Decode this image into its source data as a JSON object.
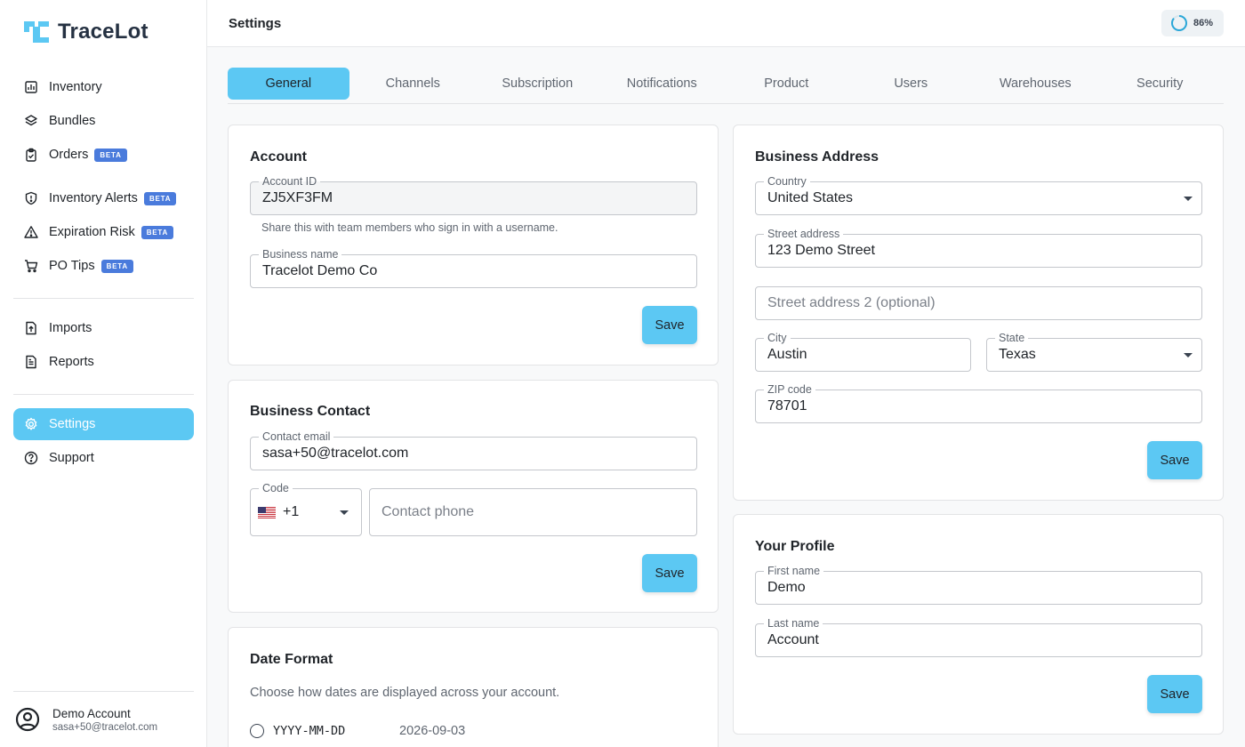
{
  "app": {
    "name": "TraceLot",
    "accent": "#5cc8f3",
    "beta_color": "#4a7bdc"
  },
  "sidebar": {
    "items": [
      {
        "label": "Inventory",
        "icon": "inventory-icon"
      },
      {
        "label": "Bundles",
        "icon": "layers-icon"
      },
      {
        "label": "Orders",
        "icon": "clipboard-icon",
        "badge": "BETA"
      },
      {
        "label": "Inventory Alerts",
        "icon": "shield-alert-icon",
        "badge": "BETA"
      },
      {
        "label": "Expiration Risk",
        "icon": "warning-triangle-icon",
        "badge": "BETA"
      },
      {
        "label": "PO Tips",
        "icon": "cart-icon",
        "badge": "BETA"
      },
      {
        "label": "Imports",
        "icon": "file-upload-icon"
      },
      {
        "label": "Reports",
        "icon": "report-icon"
      },
      {
        "label": "Settings",
        "icon": "gear-icon",
        "active": true
      },
      {
        "label": "Support",
        "icon": "help-circle-icon"
      }
    ],
    "user": {
      "name": "Demo Account",
      "email": "sasa+50@tracelot.com"
    }
  },
  "header": {
    "title": "Settings",
    "progress_label": "86%",
    "progress_value": 0.86
  },
  "tabs": [
    "General",
    "Channels",
    "Subscription",
    "Notifications",
    "Product",
    "Users",
    "Warehouses",
    "Security"
  ],
  "account": {
    "title": "Account",
    "account_id_label": "Account ID",
    "account_id": "ZJ5XF3FM",
    "helper": "Share this with team members who sign in with a username.",
    "business_name_label": "Business name",
    "business_name": "Tracelot Demo Co",
    "save": "Save"
  },
  "contact": {
    "title": "Business Contact",
    "email_label": "Contact email",
    "email": "sasa+50@tracelot.com",
    "code_label": "Code",
    "code": "+1",
    "phone_placeholder": "Contact phone",
    "save": "Save"
  },
  "date_format": {
    "title": "Date Format",
    "description": "Choose how dates are displayed across your account.",
    "options": [
      {
        "format": "YYYY-MM-DD",
        "example": "2026-09-03"
      }
    ]
  },
  "address": {
    "title": "Business Address",
    "country_label": "Country",
    "country": "United States",
    "street_label": "Street address",
    "street": "123 Demo Street",
    "street2_placeholder": "Street address 2 (optional)",
    "city_label": "City",
    "city": "Austin",
    "state_label": "State",
    "state": "Texas",
    "zip_label": "ZIP code",
    "zip": "78701",
    "save": "Save"
  },
  "profile": {
    "title": "Your Profile",
    "first_name_label": "First name",
    "first_name": "Demo",
    "last_name_label": "Last name",
    "last_name": "Account",
    "save": "Save"
  }
}
